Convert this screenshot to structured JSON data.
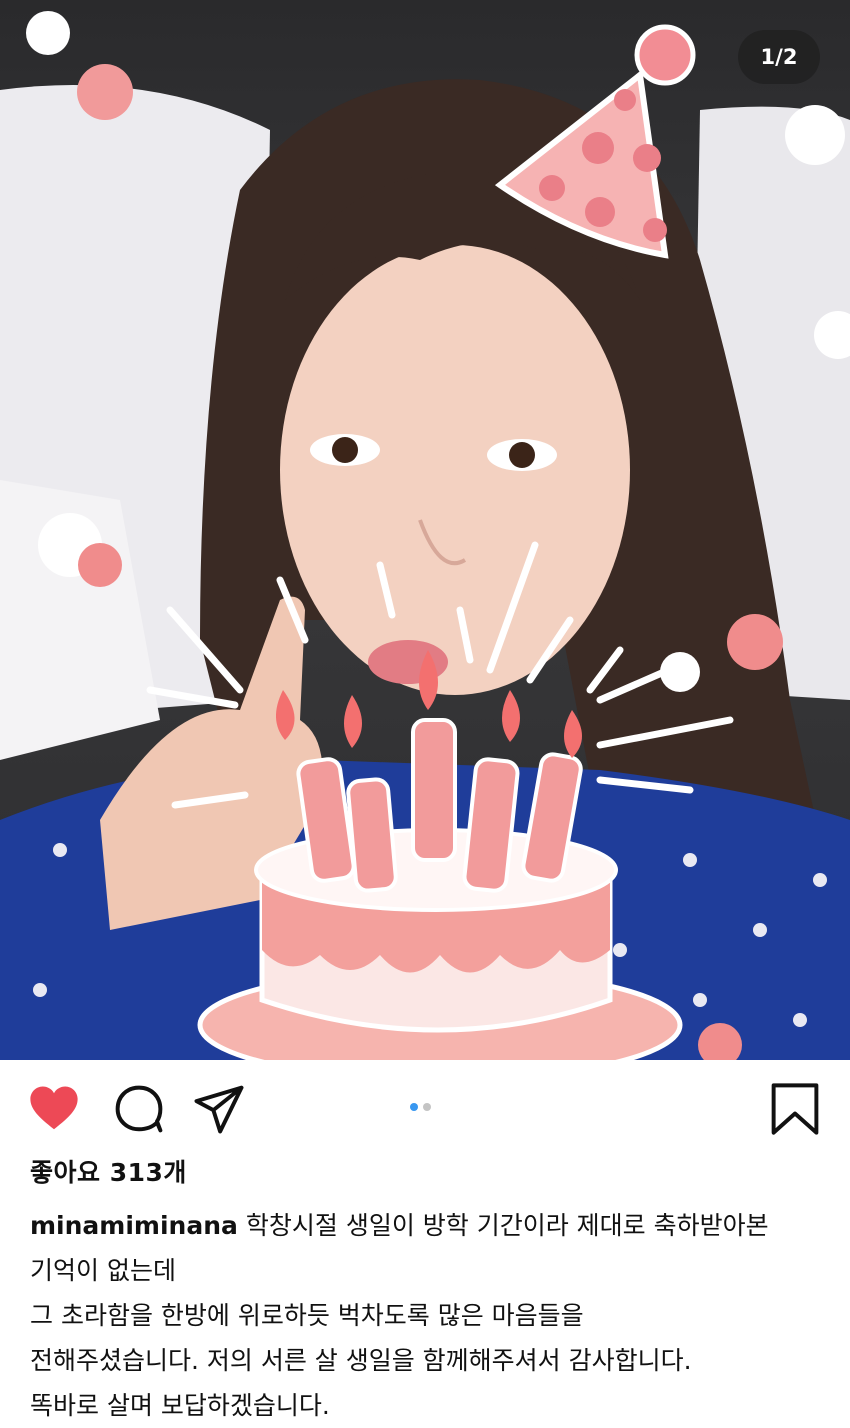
{
  "media": {
    "counter": "1/2",
    "carousel_total": 2,
    "carousel_active": 1,
    "alt_items": [
      "photo",
      "party-hat-sticker",
      "birthday-cake-sticker"
    ]
  },
  "actions": {
    "like_icon": "heart-filled-icon",
    "comment_icon": "comment-bubble-icon",
    "share_icon": "paper-plane-icon",
    "save_icon": "bookmark-icon",
    "like_color": "#ed4956"
  },
  "post": {
    "likes": "좋아요 313개",
    "username": "minamiminana",
    "caption_first": "학창시절 생일이 방학 기간이라 제대로 축하받아본",
    "caption_lines": [
      "기억이 없는데",
      "그 초라함을 한방에 위로하듯 벅차도록 많은 마음들을",
      "전해주셨습니다. 저의 서른 살 생일을 함께해주셔서 감사합니다.",
      "똑바로 살며 보답하겠습니다."
    ]
  }
}
